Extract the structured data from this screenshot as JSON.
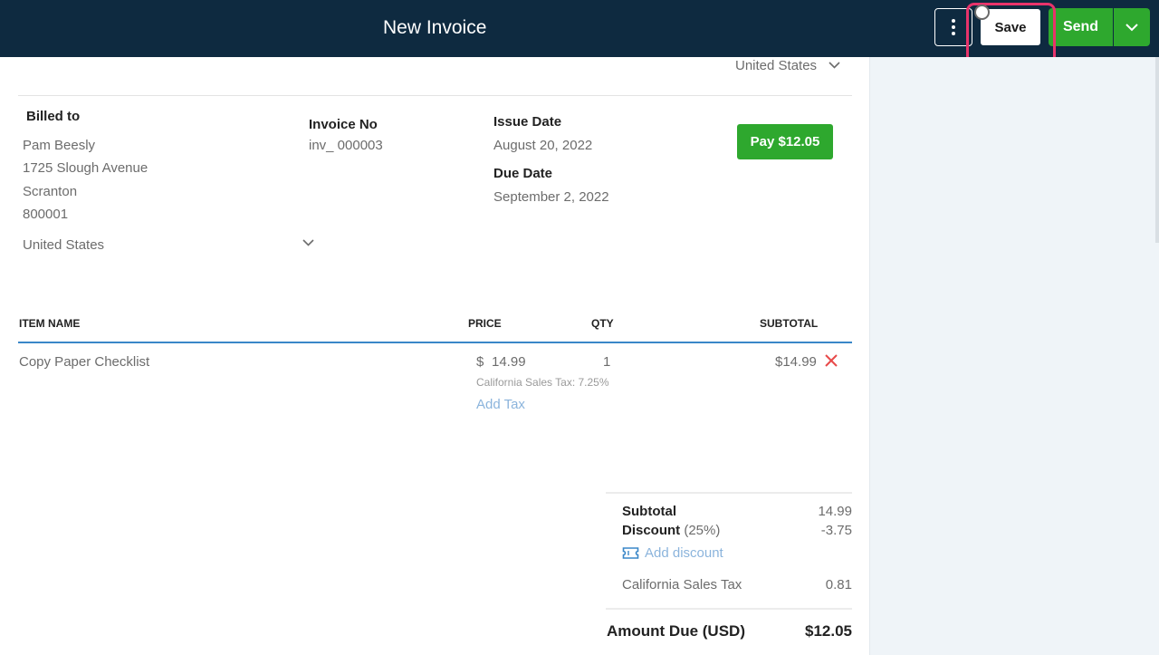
{
  "header": {
    "title": "New Invoice",
    "save_label": "Save",
    "send_label": "Send"
  },
  "company": {
    "country": "United States"
  },
  "billed_to": {
    "label": "Billed to",
    "name": "Pam Beesly",
    "address1": "1725 Slough Avenue",
    "city": "Scranton",
    "zip": "800001",
    "country": "United States"
  },
  "invoice": {
    "number_label": "Invoice No",
    "number": "inv_ 000003",
    "issue_label": "Issue Date",
    "issue_date": "August 20, 2022",
    "due_label": "Due Date",
    "due_date": "September 2, 2022",
    "pay_label": "Pay $12.05"
  },
  "table": {
    "headers": {
      "item": "ITEM NAME",
      "price": "PRICE",
      "qty": "QTY",
      "subtotal": "SUBTOTAL"
    },
    "rows": [
      {
        "name": "Copy Paper Checklist",
        "currency": "$",
        "price": "14.99",
        "qty": "1",
        "subtotal": "$14.99",
        "tax_note": "California Sales Tax: 7.25%",
        "add_tax": "Add Tax"
      }
    ]
  },
  "summary": {
    "subtotal_label": "Subtotal",
    "subtotal": "14.99",
    "discount_label": "Discount",
    "discount_pct": "(25%)",
    "discount": "-3.75",
    "add_discount": "Add discount",
    "tax_label": "California Sales Tax",
    "tax": "0.81",
    "amount_due_label": "Amount Due (USD)",
    "amount_due": "$12.05"
  },
  "colors": {
    "header_bg": "#0e2a40",
    "accent_green": "#2ea82e",
    "link_blue": "#8bb4dc",
    "highlight_pink": "#e8336b"
  }
}
